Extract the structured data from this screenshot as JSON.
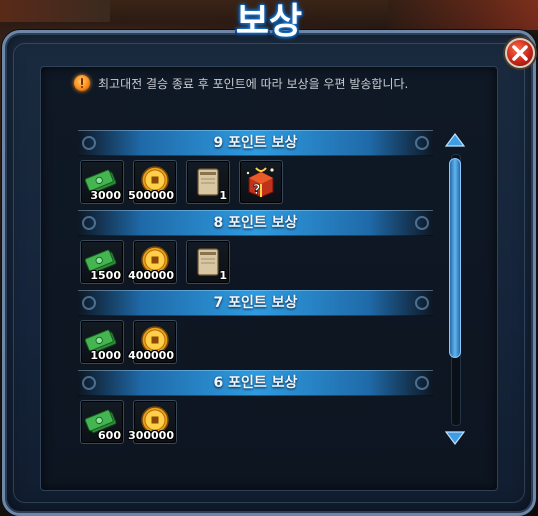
{
  "title": "보상",
  "notice": "최고대전 결승 종료 후 포인트에 따라 보상을 우편 발송합니다.",
  "sections": [
    {
      "label": "9 포인트 보상",
      "items": [
        {
          "icon": "cash-icon",
          "qty": "3000"
        },
        {
          "icon": "gold-coin-icon",
          "qty": "500000"
        },
        {
          "icon": "scroll-ticket-icon",
          "qty": "1"
        },
        {
          "icon": "mystery-box-icon",
          "qty": ""
        }
      ]
    },
    {
      "label": "8 포인트 보상",
      "items": [
        {
          "icon": "cash-icon",
          "qty": "1500"
        },
        {
          "icon": "gold-coin-icon",
          "qty": "400000"
        },
        {
          "icon": "scroll-ticket-icon",
          "qty": "1"
        }
      ]
    },
    {
      "label": "7 포인트 보상",
      "items": [
        {
          "icon": "cash-icon",
          "qty": "1000"
        },
        {
          "icon": "gold-coin-icon",
          "qty": "400000"
        }
      ]
    },
    {
      "label": "6 포인트 보상",
      "items": [
        {
          "icon": "cash-icon",
          "qty": "600"
        },
        {
          "icon": "gold-coin-icon",
          "qty": "300000"
        }
      ]
    }
  ],
  "colors": {
    "accent": "#2f9be0",
    "frame": "#6e87a6",
    "close": "#c7261a"
  }
}
